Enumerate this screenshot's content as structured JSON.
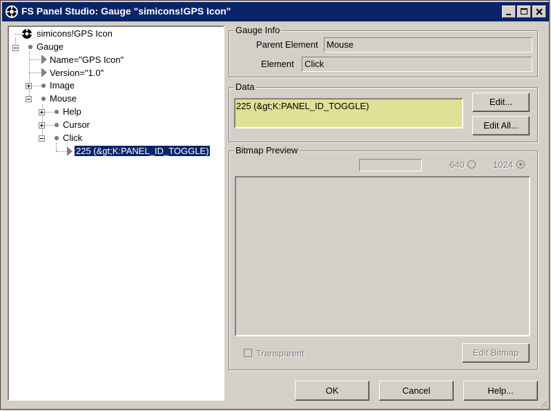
{
  "window": {
    "title": "FS Panel Studio: Gauge \"simicons!GPS Icon\""
  },
  "tree": {
    "root": "simicons!GPS Icon",
    "gauge": "Gauge",
    "name_attr": "Name=\"GPS Icon\"",
    "version_attr": "Version=\"1.0\"",
    "image": "Image",
    "mouse": "Mouse",
    "help": "Help",
    "cursor": "Cursor",
    "click": "Click",
    "click_value": "225 (&gt;K:PANEL_ID_TOGGLE)"
  },
  "gauge_info": {
    "legend": "Gauge Info",
    "parent_label": "Parent Element",
    "parent_value": "Mouse",
    "element_label": "Element",
    "element_value": "Click"
  },
  "data_group": {
    "legend": "Data",
    "value": "225 (&gt;K:PANEL_ID_TOGGLE)",
    "edit_button": "Edit...",
    "edit_all_button": "Edit All...",
    "field_color": "#e0e096"
  },
  "bitmap_preview": {
    "legend": "Bitmap Preview",
    "radio_640": "640",
    "radio_1024": "1024",
    "selected_resolution": "1024",
    "transparent_label": "Transparent",
    "edit_bitmap_button": "Edit Bitmap"
  },
  "footer": {
    "ok": "OK",
    "cancel": "Cancel",
    "help": "Help..."
  },
  "colors": {
    "titlebar": "#0a246a",
    "face": "#d4d0c8",
    "selection": "#0a246a"
  }
}
